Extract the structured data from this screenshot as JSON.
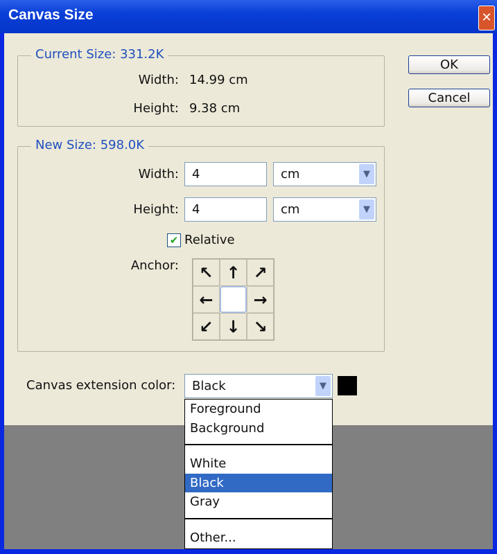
{
  "window": {
    "title": "Canvas Size",
    "close_icon": "close-icon"
  },
  "current_size": {
    "legend": "Current Size: 331.2K",
    "width_label": "Width:",
    "width_value": "14.99 cm",
    "height_label": "Height:",
    "height_value": "9.38 cm"
  },
  "new_size": {
    "legend": "New Size: 598.0K",
    "width_label": "Width:",
    "width_value": "4",
    "width_unit": "cm",
    "height_label": "Height:",
    "height_value": "4",
    "height_unit": "cm",
    "relative_label": "Relative",
    "relative_checked": true,
    "anchor_label": "Anchor:",
    "anchor_arrows": [
      "↖",
      "↑",
      "↗",
      "←",
      "",
      "→",
      "↙",
      "↓",
      "↘"
    ]
  },
  "buttons": {
    "ok": "OK",
    "cancel": "Cancel"
  },
  "extension": {
    "label": "Canvas extension color:",
    "selected": "Black",
    "swatch_color": "#000000",
    "options": [
      "Foreground",
      "Background",
      "White",
      "Black",
      "Gray",
      "Other..."
    ]
  },
  "colors": {
    "accent": "#1f4fbf",
    "highlight": "#316ac5",
    "titlebar": "#0a3fd8"
  }
}
